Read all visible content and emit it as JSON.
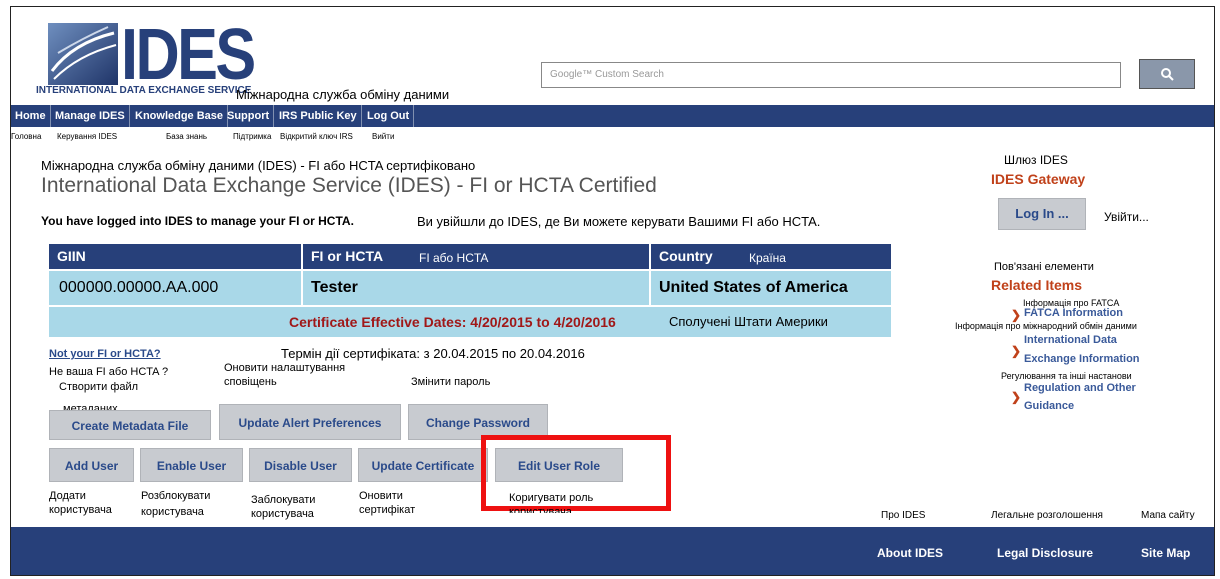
{
  "header": {
    "logo_text": "IDES",
    "logo_subtitle": "INTERNATIONAL DATA EXCHANGE SERVICE",
    "logo_subtitle_ua": "Міжнародна служба обміну даними",
    "search_placeholder": "Google™ Custom Search",
    "search_button_icon": "search-icon"
  },
  "nav": {
    "items": [
      "Home",
      "Manage IDES",
      "Knowledge Base",
      "Support",
      "IRS Public Key",
      "Log Out"
    ],
    "items_ua": [
      "Головна",
      "Керування IDES",
      "База знань",
      "Підтримка",
      "Відкритий ключ IRS",
      "Вийти"
    ]
  },
  "main": {
    "title_ua": "Міжнародна служба обміну даними (IDES) - FI або HCTA сертифіковано",
    "title": "International Data Exchange Service (IDES) - FI or HCTA Certified",
    "logged_in": "You have logged into IDES to manage your FI or HCTA.",
    "logged_in_ua": "Ви увійшли до IDES, де Ви можете керувати Вашими FI або HCTA.",
    "table": {
      "headers": [
        "GIIN",
        "FI or HCTA",
        "Country"
      ],
      "headers_ua": [
        "FI або HCTA",
        "Країна"
      ],
      "row": [
        "000000.00000.AA.000",
        "Tester",
        "United States of America"
      ],
      "certificate": "Certificate Effective Dates: 4/20/2015 to 4/20/2016",
      "certificate_country_ua": "Сполучені Штати Америки"
    },
    "cert_dates_ua": "Термін дії сертифіката: з 20.04.2015 по 20.04.2016",
    "not_your_fi": "Not your FI or HCTA?",
    "not_your_fi_ua": "Не ваша FI або HCTA ?",
    "update_alert_ua_1": "Оновити налаштування",
    "update_alert_ua_2": "сповіщень",
    "change_password_ua": "Змінити пароль",
    "create_metadata_ua_1": "Створити файл",
    "create_metadata_ua_2": "метаданих",
    "buttons_row1": [
      "Create Metadata File",
      "Update Alert Preferences",
      "Change Password"
    ],
    "buttons_row2": [
      "Add User",
      "Enable User",
      "Disable User",
      "Update Certificate",
      "Edit User Role"
    ],
    "buttons_row2_ua": [
      [
        "Додати",
        "користувача"
      ],
      [
        "Розблокувати",
        "користувача"
      ],
      [
        "Заблокувати",
        "користувача"
      ],
      [
        "Оновити",
        "сертифікат"
      ],
      [
        "Коригувати роль",
        "користувача"
      ]
    ]
  },
  "sidebar": {
    "gateway_ua": "Шлюз IDES",
    "gateway": "IDES Gateway",
    "login": "Log In ...",
    "login_ua": "Увійти...",
    "related_ua": "Пов'язані елементи",
    "related": "Related Items",
    "items": [
      {
        "ua": "Інформація про FATCA",
        "label": "FATCA Information"
      },
      {
        "ua": "Інформація про міжнародний обмін даними",
        "label1": "International Data",
        "label2": "Exchange Information"
      },
      {
        "ua": "Регулювання та інші настанови",
        "label1": "Regulation and Other",
        "label2": "Guidance"
      }
    ]
  },
  "footer": {
    "links": [
      "About IDES",
      "Legal Disclosure",
      "Site Map"
    ],
    "links_ua": [
      "Про IDES",
      "Легальне розголошення",
      "Мапа сайту"
    ]
  },
  "colors": {
    "nav_blue": "#27407a",
    "table_light": "#a9d8e8",
    "cert_red": "#a01818",
    "highlight_red": "#ee1111",
    "sidebar_orange": "#c0411a"
  }
}
